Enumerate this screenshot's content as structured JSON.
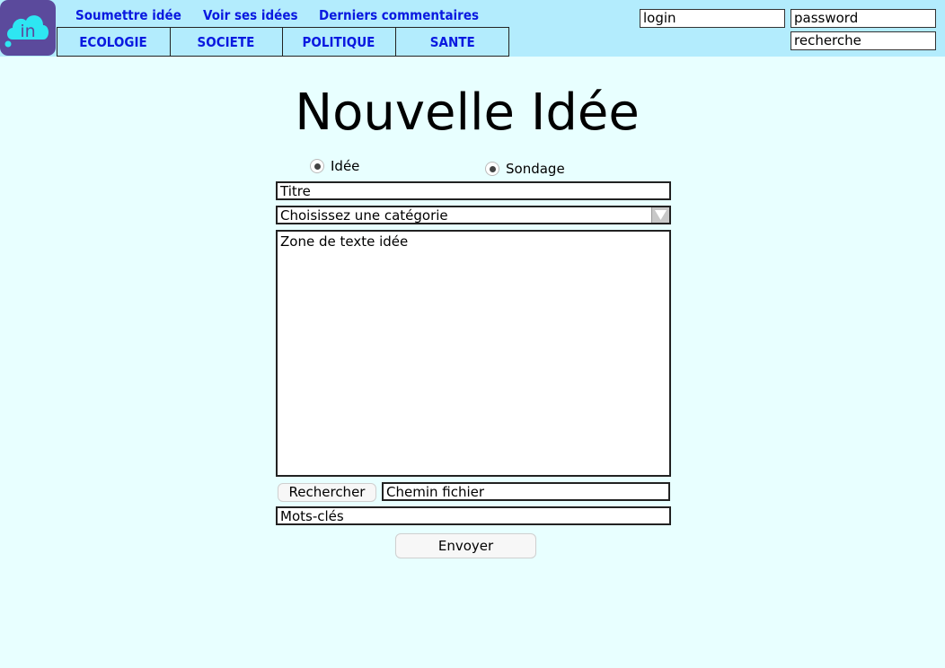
{
  "app": {
    "logo_text": "in"
  },
  "nav": {
    "links": [
      "Soumettre idée",
      "Voir ses idées",
      "Derniers commentaires"
    ],
    "categories": [
      "ECOLOGIE",
      "SOCIETE",
      "POLITIQUE",
      "SANTE"
    ]
  },
  "auth": {
    "login": "login",
    "password": "password",
    "search": "recherche"
  },
  "form": {
    "title": "Nouvelle Idée",
    "type_options": [
      "Idée",
      "Sondage"
    ],
    "title_field": "Titre",
    "category_select": "Choisissez une catégorie",
    "text_area": "Zone de texte idée",
    "browse_button": "Rechercher",
    "file_path": "Chemin fichier",
    "keywords": "Mots-clés",
    "submit_button": "Envoyer"
  },
  "colors": {
    "header_bg": "#b3ecfd",
    "page_bg": "#e8ffff",
    "link": "#0a19e0",
    "logo_bg": "#5b4a9c",
    "logo_cloud": "#2ee6f2"
  }
}
